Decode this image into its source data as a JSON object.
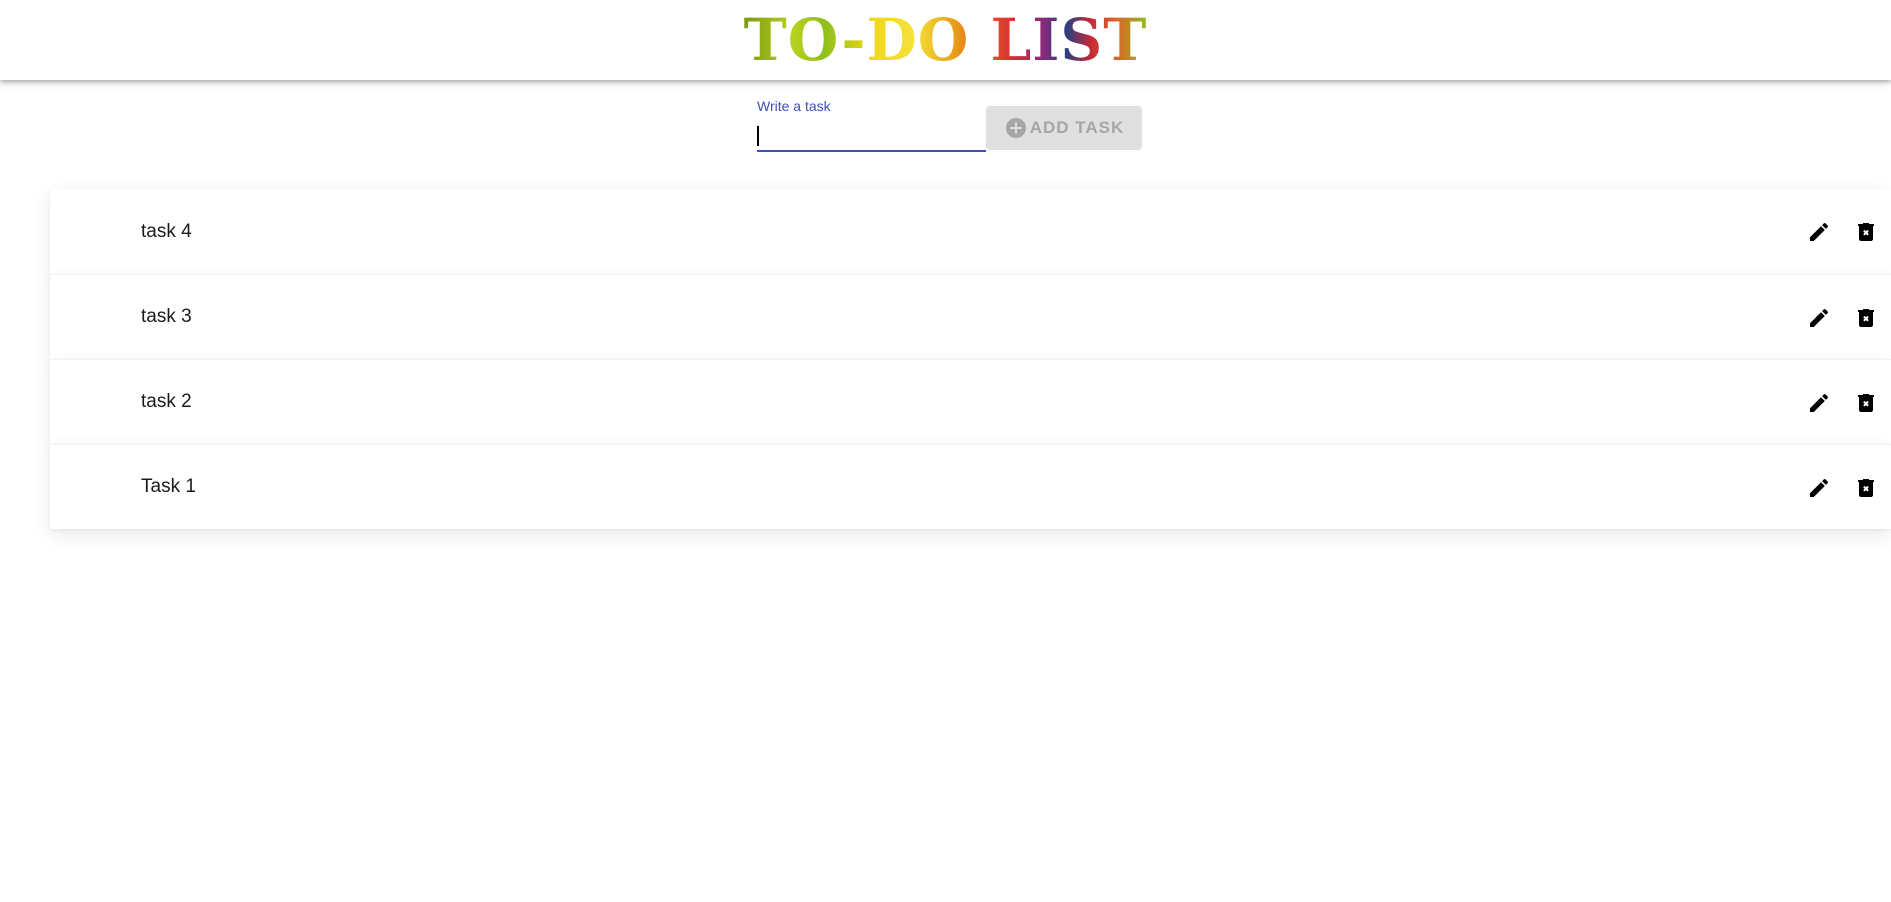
{
  "app": {
    "title": "TO-DO LIST"
  },
  "form": {
    "input_label": "Write a task",
    "input_value": "",
    "add_button_label": "ADD TASK"
  },
  "tasks": [
    {
      "text": "task 4",
      "edit_icon": "pencil-icon",
      "delete_icon": "delete-x-icon"
    },
    {
      "text": "task 3",
      "edit_icon": "pencil-icon",
      "delete_icon": "delete-x-icon"
    },
    {
      "text": "task 2",
      "edit_icon": "pencil-icon",
      "delete_icon": "delete-x-icon"
    },
    {
      "text": "Task 1",
      "edit_icon": "pencil-icon",
      "delete_icon": "delete-x-icon"
    }
  ],
  "colors": {
    "accent": "#3f51b5",
    "button_disabled_bg": "#e0e0e0",
    "button_disabled_text": "#a6a6a6"
  }
}
